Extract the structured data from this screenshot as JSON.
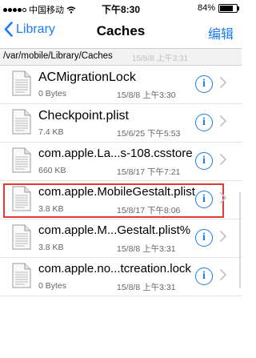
{
  "status_bar": {
    "carrier": "中国移动",
    "time": "下午8:30",
    "battery_percent": "84%",
    "battery_level": 0.84,
    "signal_icon": "signal-dots-icon",
    "wifi_icon": "wifi-icon",
    "battery_icon": "battery-icon"
  },
  "nav": {
    "back_label": "Library",
    "title": "Caches",
    "edit_label": "编辑"
  },
  "path": {
    "text": "/var/mobile/Library/Caches",
    "ghost_date": "15/8/8 上午3:31"
  },
  "files": [
    {
      "name": "ACMigrationLock",
      "size": "0 Bytes",
      "date": "15/8/8 上午3:30",
      "highlight": false
    },
    {
      "name": "Checkpoint.plist",
      "size": "7.4 KB",
      "date": "15/6/25 下午5:53",
      "highlight": false
    },
    {
      "name": "com.apple.La...s-108.csstore",
      "size": "660 KB",
      "date": "15/8/17 下午7:21",
      "highlight": false
    },
    {
      "name": "com.apple.MobileGestalt.plist",
      "size": "3.8 KB",
      "date": "15/8/17 下午8:06",
      "highlight": true
    },
    {
      "name": "com.apple.M...Gestalt.plist%",
      "size": "3.8 KB",
      "date": "15/8/8 上午3:31",
      "highlight": false
    },
    {
      "name": "com.apple.no...tcreation.lock",
      "size": "0 Bytes",
      "date": "15/8/8 上午3:31",
      "highlight": false
    }
  ],
  "accent_color": "#1a7cf5",
  "highlight_color": "#e53935"
}
